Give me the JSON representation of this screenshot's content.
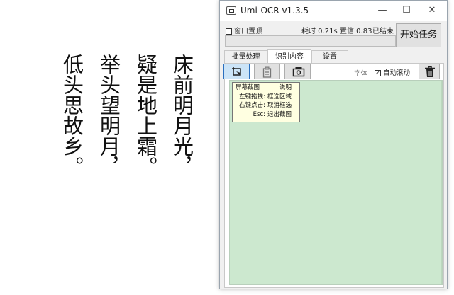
{
  "poem": {
    "columns": [
      "床前明月光，",
      "疑是地上霜。",
      "举头望明月，",
      "低头思故乡。"
    ]
  },
  "window": {
    "title": "Umi-OCR v1.3.5",
    "min_label": "—",
    "max_label": "☐",
    "close_label": "✕"
  },
  "status": {
    "topmost_label": "窗口置顶",
    "time_label": "耗时 0.21s",
    "confidence_label": "置信 0.83",
    "state_label": "已结束",
    "start_button": "开始任务"
  },
  "tabs": [
    {
      "label": "批量处理"
    },
    {
      "label": "识别内容"
    },
    {
      "label": "设置"
    }
  ],
  "toolbar": {
    "font_label": "字体",
    "auto_scroll_label": "自动滚动",
    "auto_scroll_checked": "✓"
  },
  "tooltip": {
    "header_key": "屏幕截图",
    "header_val": "说明",
    "rows": [
      {
        "key": "左键拖拽:",
        "val": "框选区域"
      },
      {
        "key": "右键点击:",
        "val": "取消框选"
      },
      {
        "key": "Esc:",
        "val": "退出截图"
      }
    ]
  },
  "colors": {
    "text_area_bg": "#cce8cf",
    "tooltip_bg": "#ffffe1",
    "selected_tool": "#cce4f7"
  }
}
